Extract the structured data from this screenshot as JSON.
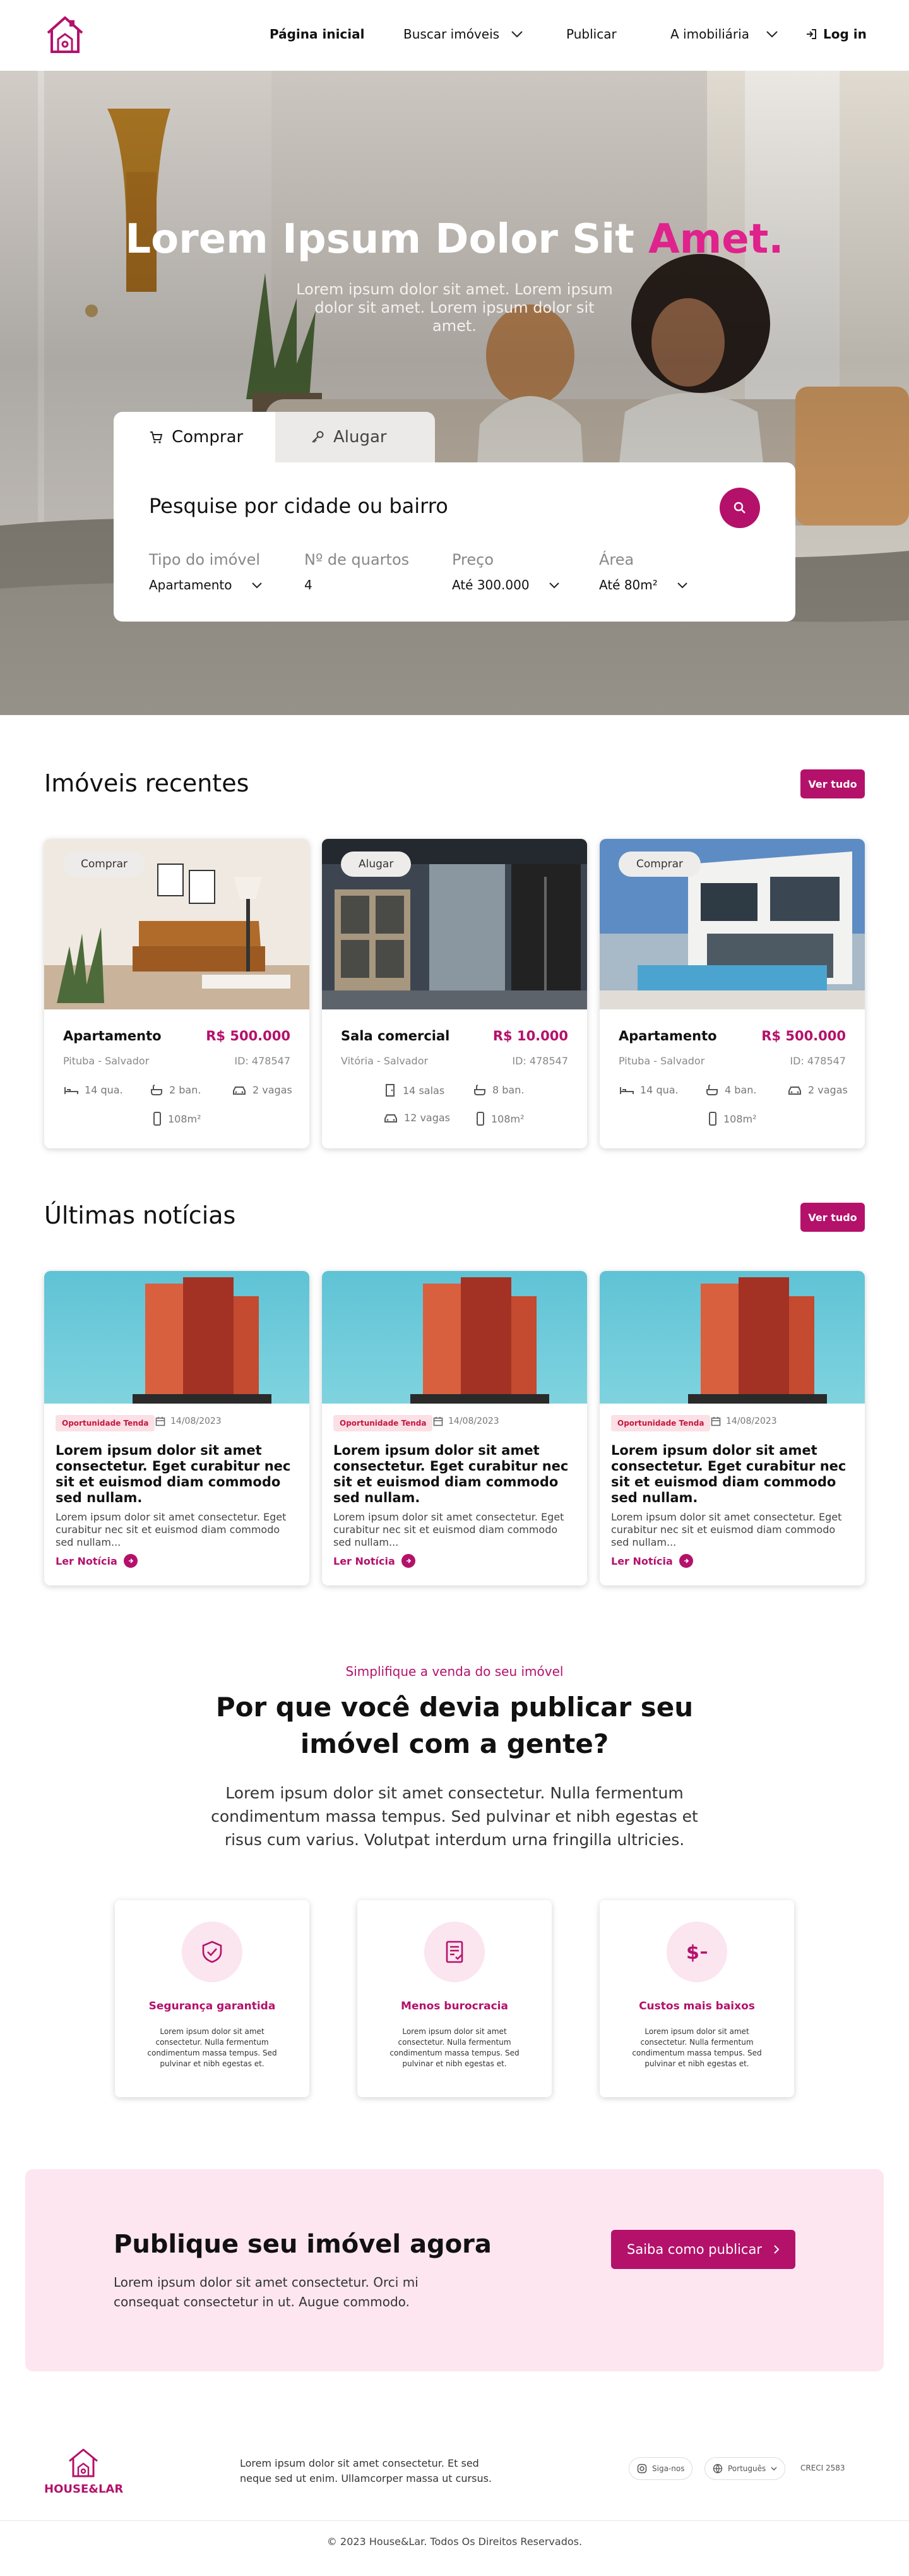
{
  "brand": {
    "name": "HOUSE&LAR",
    "accent": "#b4116b",
    "highlight": "#e0228c"
  },
  "nav": {
    "home": "Página inicial",
    "search": "Buscar imóveis",
    "publish": "Publicar",
    "agency": "A imobiliária",
    "login": "Log in"
  },
  "hero": {
    "title_main": "Lorem Ipsum Dolor Sit ",
    "title_accent": "Amet.",
    "subtitle": "Lorem ipsum dolor sit amet. Lorem ipsum dolor sit amet. Lorem ipsum dolor sit amet.",
    "tabs": {
      "buy": "Comprar",
      "rent": "Alugar"
    },
    "search_title": "Pesquise por cidade ou bairro",
    "filters": [
      {
        "label": "Tipo do imóvel",
        "value": "Apartamento"
      },
      {
        "label": "Nº de quartos",
        "value": "4"
      },
      {
        "label": "Preço",
        "value": "Até 300.000"
      },
      {
        "label": "Área",
        "value": "Até 80m²"
      }
    ]
  },
  "recent": {
    "title": "Imóveis recentes",
    "see_all": "Ver tudo",
    "cards": [
      {
        "badge": "Comprar",
        "title": "Apartamento",
        "price": "R$ 500.000",
        "location": "Pituba - Salvador",
        "id": "ID: 478547",
        "features": [
          "14 qua.",
          "2 ban.",
          "2 vagas",
          "108m²"
        ]
      },
      {
        "badge": "Alugar",
        "title": "Sala comercial",
        "price": "R$ 10.000",
        "location": "Vitória - Salvador",
        "id": "ID: 478547",
        "features": [
          "14 salas",
          "8 ban.",
          "12 vagas",
          "108m²"
        ]
      },
      {
        "badge": "Comprar",
        "title": "Apartamento",
        "price": "R$ 500.000",
        "location": "Pituba - Salvador",
        "id": "ID: 478547",
        "features": [
          "14 qua.",
          "4 ban.",
          "2 vagas",
          "108m²"
        ]
      }
    ]
  },
  "news": {
    "title": "Últimas notícias",
    "see_all": "Ver tudo",
    "cards": [
      {
        "tag": "Oportunidade Tenda",
        "date": "14/08/2023",
        "headline": "Lorem ipsum dolor sit amet consectetur. Eget curabitur nec sit et euismod diam commodo sed nullam.",
        "excerpt": "Lorem ipsum dolor sit amet consectetur. Eget curabitur nec sit et euismod diam commodo sed nullam...",
        "link": "Ler Notícia"
      },
      {
        "tag": "Oportunidade Tenda",
        "date": "14/08/2023",
        "headline": "Lorem ipsum dolor sit amet consectetur. Eget curabitur nec sit et euismod diam commodo sed nullam.",
        "excerpt": "Lorem ipsum dolor sit amet consectetur. Eget curabitur nec sit et euismod diam commodo sed nullam...",
        "link": "Ler Notícia"
      },
      {
        "tag": "Oportunidade Tenda",
        "date": "14/08/2023",
        "headline": "Lorem ipsum dolor sit amet consectetur. Eget curabitur nec sit et euismod diam commodo sed nullam.",
        "excerpt": "Lorem ipsum dolor sit amet consectetur. Eget curabitur nec sit et euismod diam commodo sed nullam...",
        "link": "Ler Notícia"
      }
    ]
  },
  "why": {
    "eyebrow": "Simplifique a venda do seu imóvel",
    "title": "Por que você devia publicar seu imóvel com a gente?",
    "text": "Lorem ipsum dolor sit amet consectetur. Nulla fermentum condimentum massa tempus. Sed pulvinar et nibh egestas et risus cum varius. Volutpat interdum urna fringilla ultricies.",
    "cards": [
      {
        "icon": "shield-check-icon",
        "title": "Segurança garantida",
        "text": "Lorem ipsum dolor sit amet consectetur. Nulla fermentum condimentum massa tempus. Sed pulvinar et nibh egestas et."
      },
      {
        "icon": "document-check-icon",
        "title": "Menos burocracia",
        "text": "Lorem ipsum dolor sit amet consectetur. Nulla fermentum condimentum massa tempus. Sed pulvinar et nibh egestas et."
      },
      {
        "icon": "dollar-minus-icon",
        "title": "Custos mais baixos",
        "text": "Lorem ipsum dolor sit amet consectetur. Nulla fermentum condimentum massa tempus. Sed pulvinar et nibh egestas et."
      }
    ]
  },
  "publish": {
    "title": "Publique seu imóvel agora",
    "text": "Lorem ipsum dolor sit amet consectetur. Orci mi consequat consectetur in ut. Augue commodo.",
    "button": "Saiba como publicar"
  },
  "footer": {
    "logo_text": "HOUSE&LAR",
    "text": "Lorem ipsum dolor sit amet consectetur. Et sed neque sed ut enim. Ullamcorper massa ut cursus.",
    "social": "Siga-nos",
    "language": "Português",
    "creci": "CRECI 2583",
    "copyright": "© 2023 House&Lar. Todos Os Direitos Reservados."
  }
}
